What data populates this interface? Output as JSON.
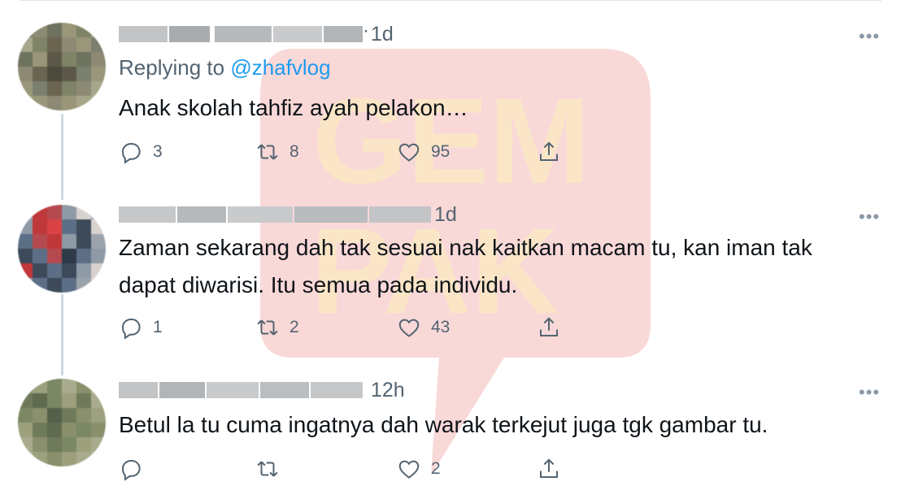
{
  "watermark": {
    "text": "GEMPAK",
    "color": "#f8d7d7"
  },
  "tweets": [
    {
      "time": "1d",
      "replying_prefix": "Replying to ",
      "replying_handle": "@zhafvlog",
      "text": "Anak skolah tahfiz ayah pelakon…",
      "replies": "3",
      "retweets": "8",
      "likes": "95",
      "avatar_colors": [
        "#7b7f6e",
        "#8c8a74",
        "#6e735f",
        "#9a9679",
        "#7f8367",
        "#a6a68a"
      ]
    },
    {
      "time": "1d",
      "text": "Zaman sekarang dah tak sesuai nak kaitkan macam tu, kan iman tak dapat diwarisi. Itu semua pada individu.",
      "replies": "1",
      "retweets": "2",
      "likes": "43",
      "avatar_colors": [
        "#c0383a",
        "#8e9aa6",
        "#3d4a5a",
        "#d8d2cf",
        "#b44a4f",
        "#5c6f86"
      ]
    },
    {
      "time": "12h",
      "text": "Betul la tu cuma ingatnya dah warak terkejut juga tgk gambar tu.",
      "replies": "",
      "retweets": "",
      "likes": "2",
      "avatar_colors": [
        "#6f7a5b",
        "#8a8f6c",
        "#5f6a4e",
        "#9da07d",
        "#7c8763",
        "#a9ab8e"
      ]
    }
  ],
  "more_label": "•••",
  "icons": [
    "reply-icon",
    "retweet-icon",
    "like-icon",
    "share-icon"
  ]
}
